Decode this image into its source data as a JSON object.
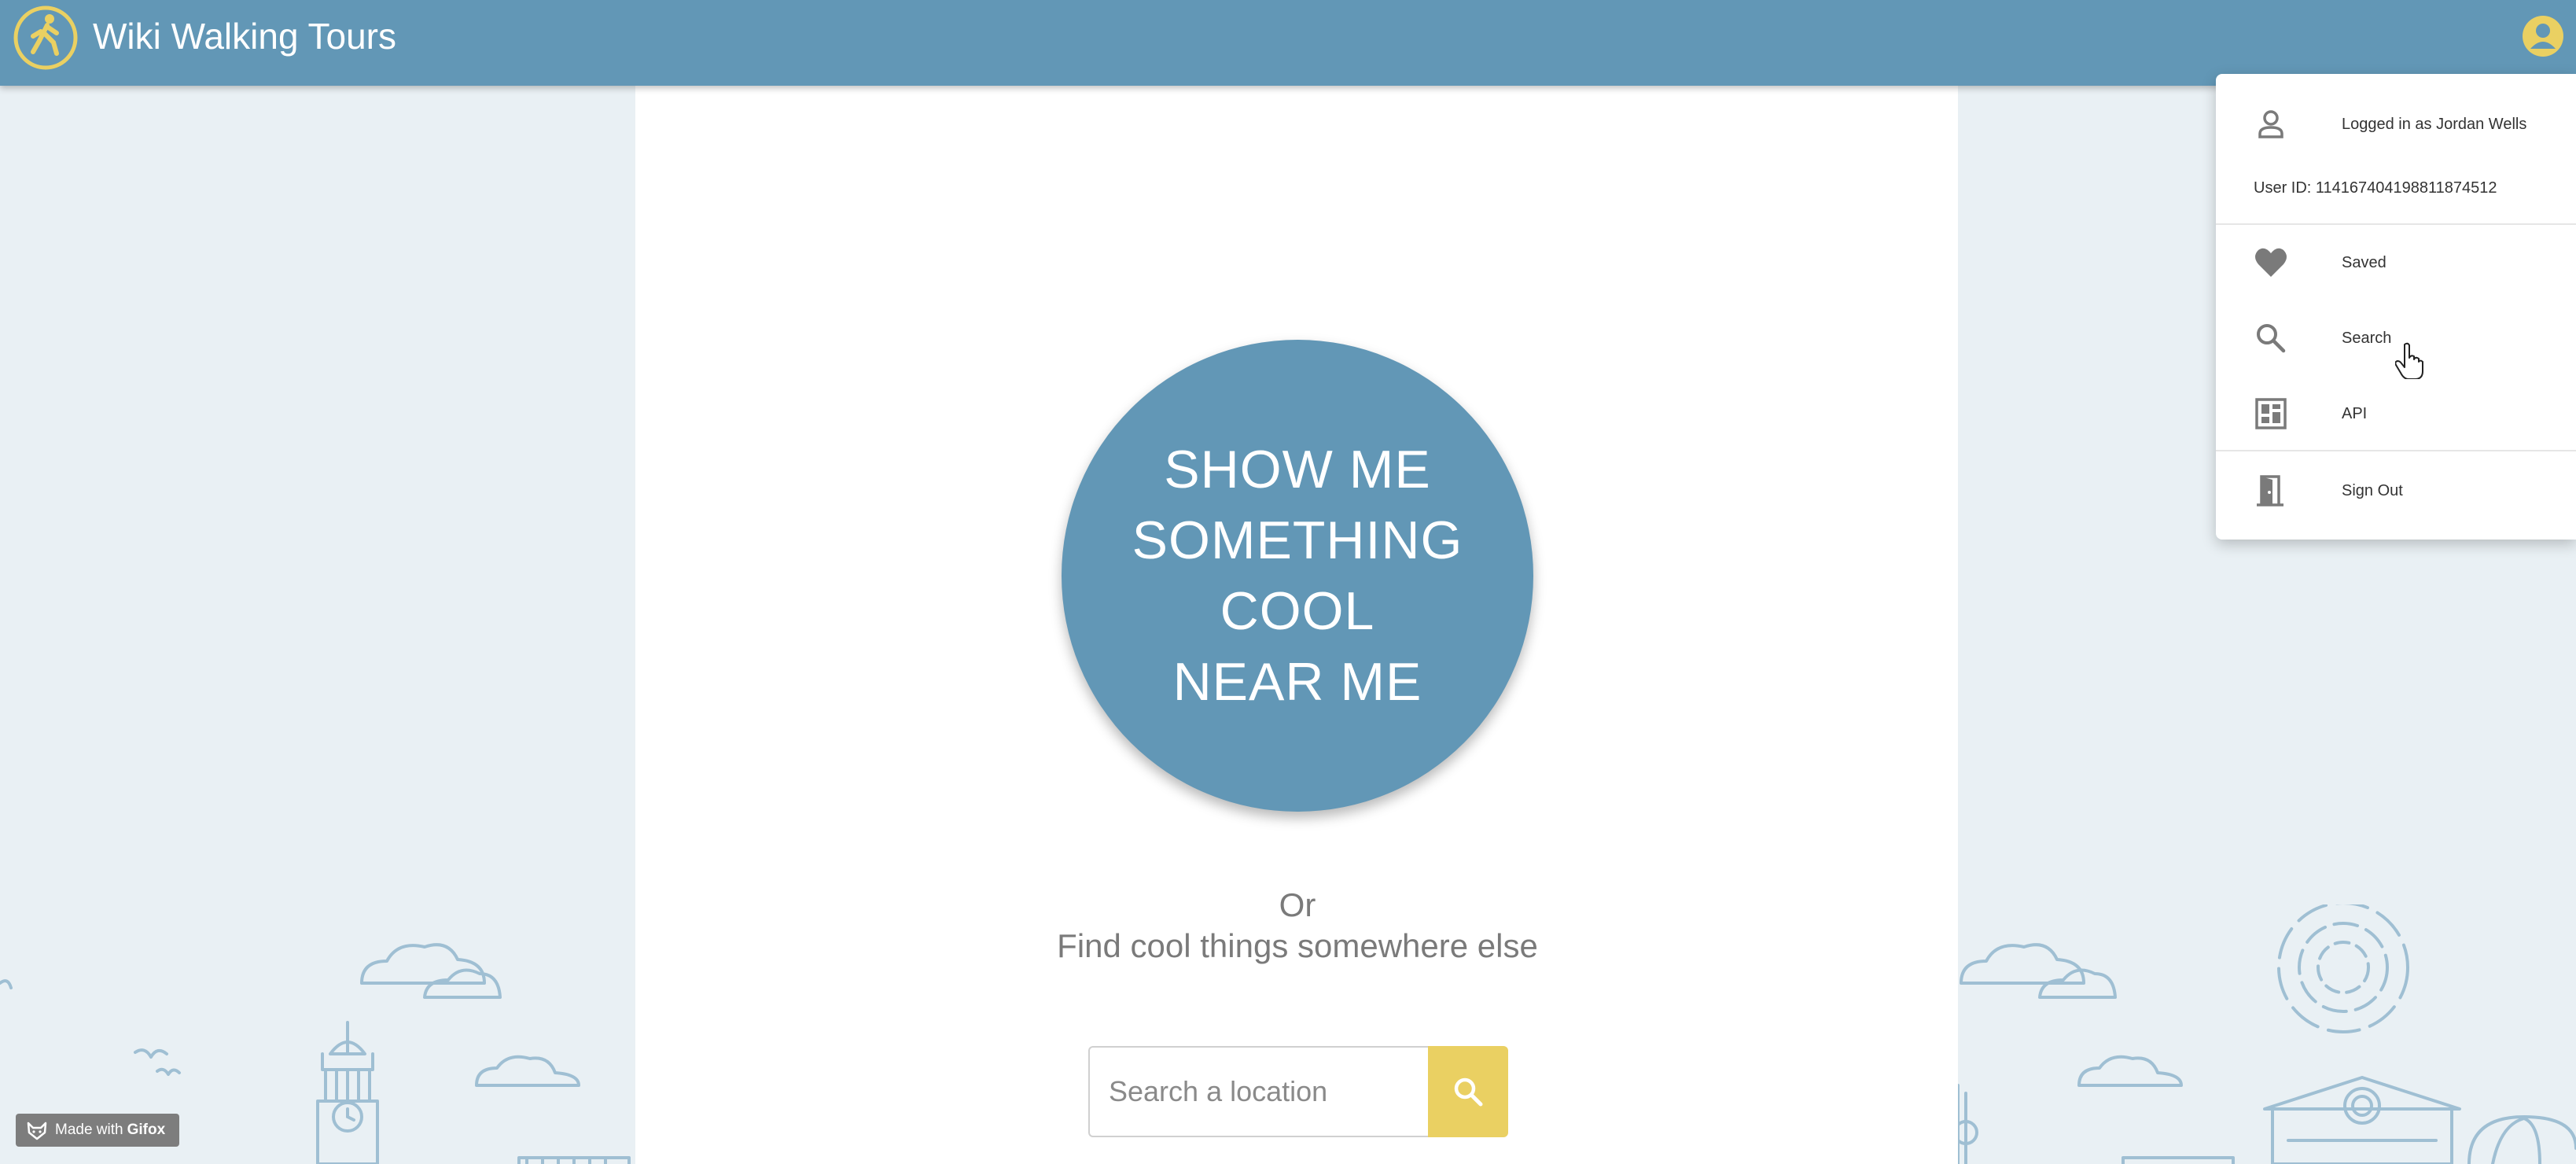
{
  "header": {
    "app_title": "Wiki Walking Tours",
    "logo_icon": "walking-person-icon",
    "account_icon": "account-circle-icon"
  },
  "main": {
    "cta_lines": [
      "SHOW ME",
      "SOMETHING",
      "COOL",
      "NEAR ME"
    ],
    "or_text": "Or",
    "find_text": "Find cool things somewhere else",
    "search": {
      "placeholder": "Search a location",
      "button_icon": "search-icon"
    }
  },
  "user_menu": {
    "logged_in_label": "Logged in as Jordan Wells",
    "user_id_label": "User ID: 114167404198811874512",
    "items": [
      {
        "label": "Saved",
        "icon": "heart-icon"
      },
      {
        "label": "Search",
        "icon": "search-icon"
      },
      {
        "label": "API",
        "icon": "api-dashboard-icon"
      }
    ],
    "sign_out_label": "Sign Out"
  },
  "badge": {
    "prefix": "Made with",
    "brand": "Gifox"
  },
  "colors": {
    "header_blue": "#6297b6",
    "accent_yellow": "#ead062",
    "page_background": "#e9f0f4",
    "illustration_stroke": "#9fbfd3"
  }
}
